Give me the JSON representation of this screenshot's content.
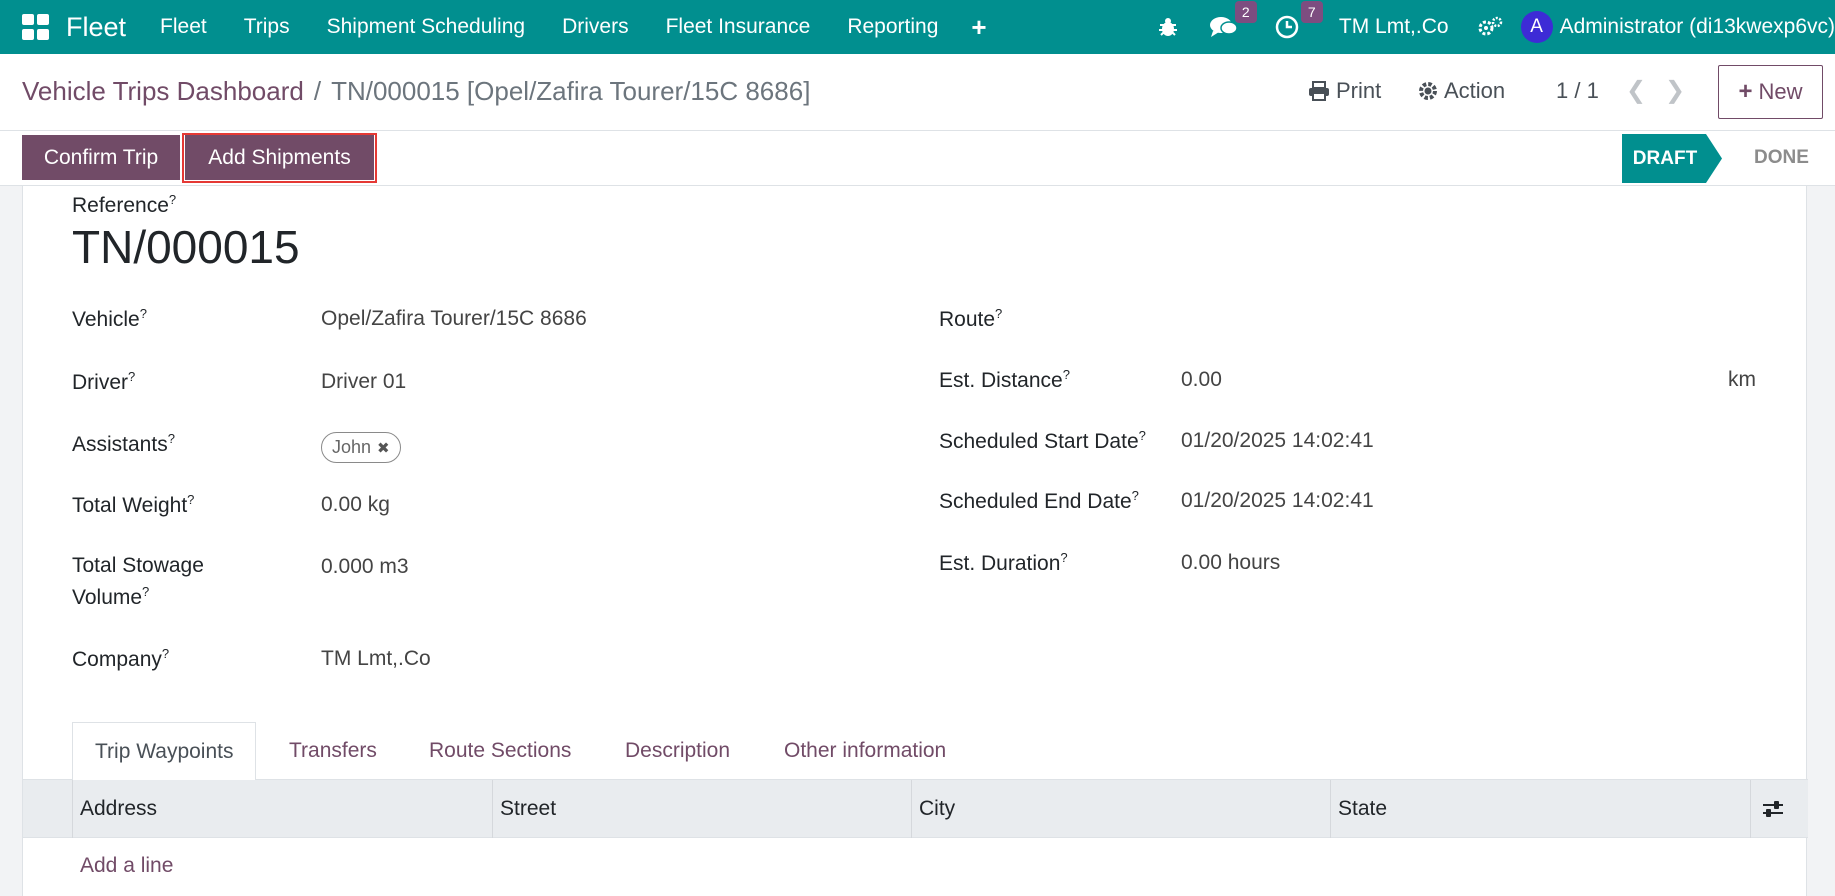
{
  "navbar": {
    "brand": "Fleet",
    "menu": [
      "Fleet",
      "Trips",
      "Shipment Scheduling",
      "Drivers",
      "Fleet Insurance",
      "Reporting"
    ],
    "messages_count": "2",
    "activities_count": "7",
    "company": "TM Lmt,.Co",
    "avatar_letter": "A",
    "user": "Administrator (di13kwexp6vc)"
  },
  "breadcrumb": {
    "parent": "Vehicle Trips Dashboard",
    "separator": "/",
    "current": "TN/000015 [Opel/Zafira Tourer/15C 8686]"
  },
  "control": {
    "print_label": "Print",
    "action_label": "Action",
    "pager": "1 / 1",
    "new_label": "New"
  },
  "statusbar": {
    "confirm_label": "Confirm Trip",
    "add_shipments_label": "Add Shipments",
    "states": [
      "DRAFT",
      "DONE"
    ],
    "current_state": "DRAFT"
  },
  "form": {
    "reference_label": "Reference",
    "reference": "TN/000015",
    "vehicle_label": "Vehicle",
    "vehicle": "Opel/Zafira Tourer/15C 8686",
    "driver_label": "Driver",
    "driver": "Driver 01",
    "assistants_label": "Assistants",
    "assistants": [
      "John"
    ],
    "total_weight_label": "Total Weight",
    "total_weight": "0.00 kg",
    "total_stowage_label_line1": "Total Stowage",
    "total_stowage_label_line2": "Volume",
    "total_stowage": "0.000 m3",
    "company_label": "Company",
    "company": "TM Lmt,.Co",
    "route_label": "Route",
    "route": "",
    "est_distance_label": "Est. Distance",
    "est_distance": "0.00",
    "est_distance_unit": "km",
    "start_date_label": "Scheduled Start Date",
    "start_date": "01/20/2025 14:02:41",
    "end_date_label": "Scheduled End Date",
    "end_date": "01/20/2025 14:02:41",
    "est_duration_label": "Est. Duration",
    "est_duration": "0.00 hours",
    "help_marker": "?"
  },
  "tabs": [
    "Trip Waypoints",
    "Transfers",
    "Route Sections",
    "Description",
    "Other information"
  ],
  "waypoints_table": {
    "columns": [
      "Address",
      "Street",
      "City",
      "State"
    ],
    "add_line_label": "Add a line"
  },
  "colors": {
    "navbar": "#018f8f",
    "primary": "#714b67",
    "highlight": "#e53935"
  }
}
